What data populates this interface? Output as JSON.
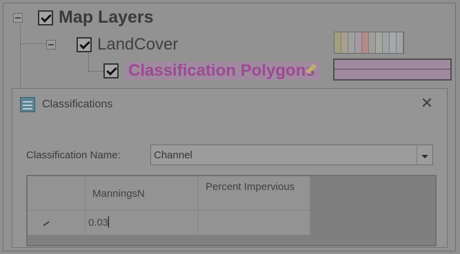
{
  "tree": {
    "root_label": "Map Layers",
    "child_label": "LandCover",
    "grandchild_label": "Classification Polygons"
  },
  "legend": {
    "colors": [
      "#a39f7f",
      "#a8a08e",
      "#a0a0a0",
      "#a69aa0",
      "#b48a8a",
      "#a0a09a",
      "#a3a9a0",
      "#9ea3a4",
      "#a4a8ac",
      "#a1a5a8"
    ]
  },
  "dialog": {
    "title": "Classifications",
    "close_symbol": "✕",
    "classification_name_label": "Classification Name:",
    "classification_name_value": "Channel",
    "grid": {
      "columns": [
        "ManningsN",
        "Percent Impervious"
      ],
      "rows": [
        {
          "manningsn": "0.03",
          "percent_impervious": ""
        }
      ]
    }
  },
  "colors": {
    "selected_layer_text": "#9c4a93",
    "selected_layer_bg": "#a08aa0"
  }
}
